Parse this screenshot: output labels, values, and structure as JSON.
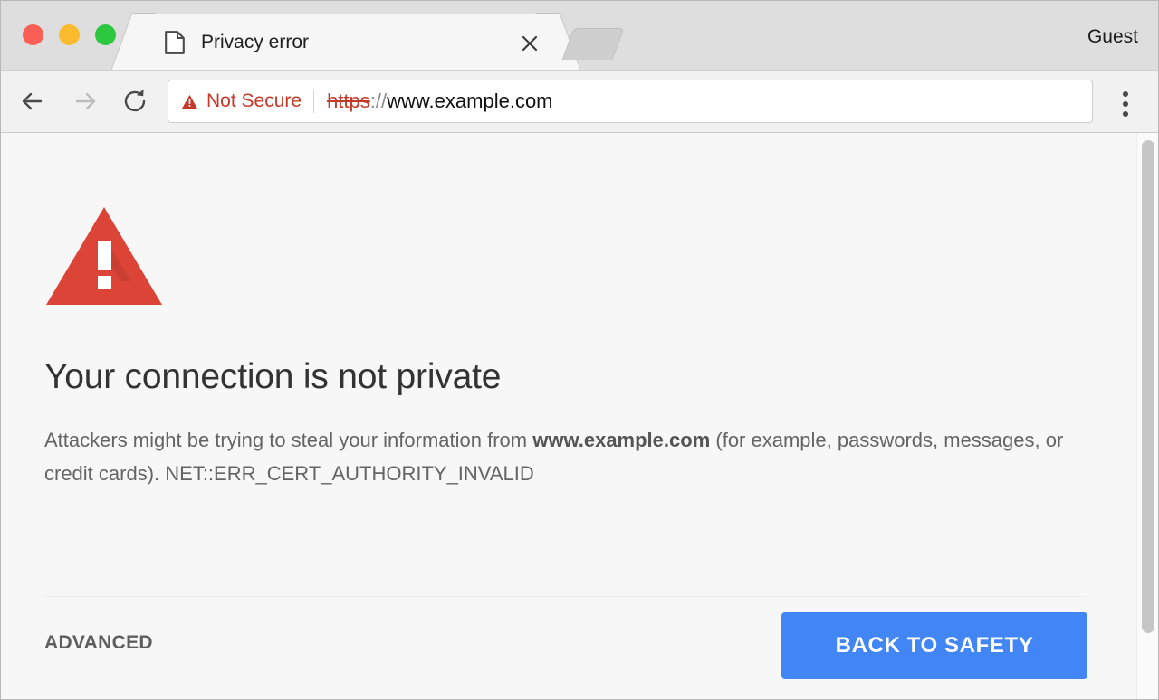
{
  "window": {
    "controls": [
      {
        "name": "close",
        "color": "#fb5f57"
      },
      {
        "name": "minimize",
        "color": "#fcbb2f"
      },
      {
        "name": "maximize",
        "color": "#2bc840"
      }
    ],
    "profile_label": "Guest"
  },
  "tab": {
    "title": "Privacy error",
    "favicon": "page-icon",
    "close_icon": "close-icon",
    "new_tab_icon": "new-tab"
  },
  "toolbar": {
    "back_icon": "arrow-left-icon",
    "forward_icon": "arrow-right-icon",
    "reload_icon": "reload-icon",
    "menu_icon": "three-dots-vertical-icon",
    "security": {
      "icon": "warning-triangle-icon",
      "label": "Not Secure",
      "color": "#c53929"
    },
    "url": {
      "scheme": "https",
      "separator": "://",
      "host": "www.example.com",
      "full": "https://www.example.com"
    }
  },
  "interstitial": {
    "icon": "warning-triangle-icon",
    "icon_color": "#db4437",
    "heading": "Your connection is not private",
    "body_prefix": "Attackers might be trying to steal your information from ",
    "body_host": "www.example.com",
    "body_suffix": " (for example, passwords, messages, or credit cards). NET::ERR_CERT_AUTHORITY_INVALID",
    "error_code": "NET::ERR_CERT_AUTHORITY_INVALID",
    "advanced_label": "ADVANCED",
    "primary_button_label": "BACK TO SAFETY",
    "primary_button_color": "#4285f4"
  },
  "scrollbar": {
    "thumb": "vertical-scroll-thumb"
  }
}
